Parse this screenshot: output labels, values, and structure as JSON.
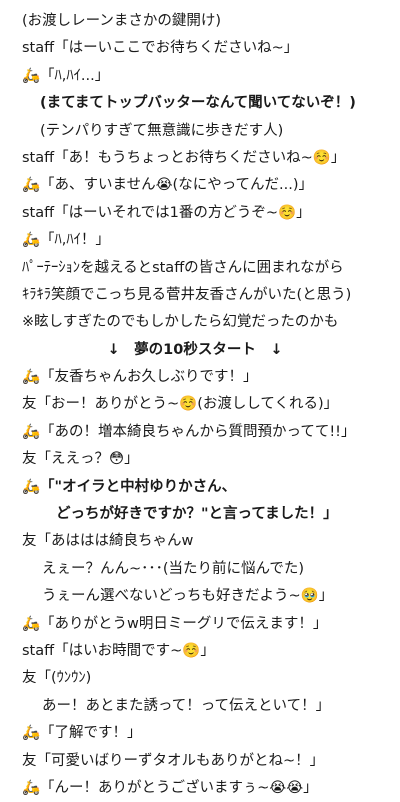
{
  "lines": [
    "(お渡しレーンまさかの鍵開け)",
    "staff「はーいここでお待ちくださいね~」",
    "🛵「ﾊ,ﾊｲ...」",
    "(まてまてトップバッターなんて聞いてないぞ！)",
    "(テンパりすぎて無意識に歩きだす人)",
    "staff「あ！もうちょっとお待ちくださいね~☺️」",
    "🛵「あ、すいません😭(なにやってんだ...)」",
    "staff「はーいそれでは1番の方どうぞ~☺️」",
    "🛵「ﾊ,ﾊｲ！」",
    "ﾊﾟｰﾃｰｼｮﾝを越えるとstaffの皆さんに囲まれながら",
    "ｷﾗｷﾗ笑顔でこっち見る菅井友香さんがいた(と思う)",
    "※眩しすぎたのでもしかしたら幻覚だったのかも",
    "↓　夢の10秒スタート　↓",
    "🛵「友香ちゃんお久しぶりです！」",
    "友「おー！ありがとう~☺️(お渡ししてくれる)」",
    "🛵「あの！増本綺良ちゃんから質問預かってて!!」",
    "友「ええっ？😳」",
    "🛵「\"オイラと中村ゆりかさん、",
    "どっちが好きですか？\"と言ってました！」",
    "友「あははは綺良ちゃんw",
    "えぇー？んん~･･･(当たり前に悩んでた)",
    "うぇーん選べないどっちも好きだよう~🥹」",
    "🛵「ありがとうw明日ミーグリで伝えます！」",
    "staff「はいお時間です~☺️」",
    "友「(ｳﾝｳﾝ)",
    "あー！あとまた誘って！って伝えといて！」",
    "🛵「了解です！」",
    "友「可愛いばりーずタオルもありがとね~！」",
    "🛵「んー！ありがとうございますぅ~😭😭」"
  ]
}
